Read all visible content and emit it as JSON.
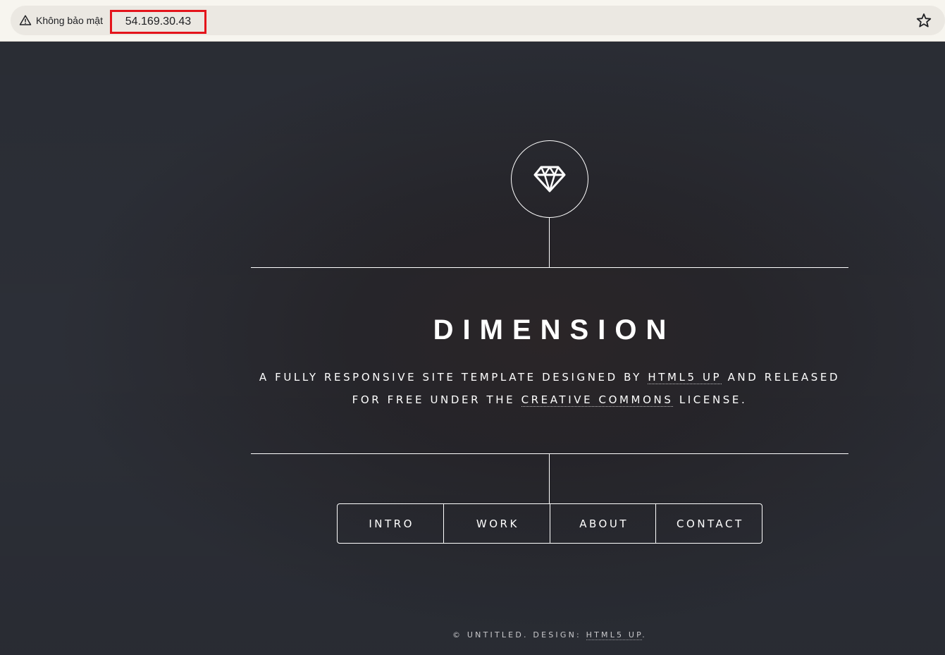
{
  "browser": {
    "security_label": "Không bảo mật",
    "url": "54.169.30.43",
    "highlight_color": "#e4141b"
  },
  "site": {
    "logo_icon": "diamond-icon",
    "title": "DIMENSION",
    "description": {
      "part1": "A FULLY RESPONSIVE SITE TEMPLATE DESIGNED BY ",
      "link1": "HTML5 UP",
      "part2": " AND RELEASED",
      "part3": "FOR FREE UNDER THE ",
      "link2": "CREATIVE COMMONS",
      "part4": " LICENSE."
    },
    "nav": [
      "INTRO",
      "WORK",
      "ABOUT",
      "CONTACT"
    ],
    "footer": {
      "text": "© UNTITLED. DESIGN: ",
      "link": "HTML5 UP",
      "end": "."
    }
  }
}
